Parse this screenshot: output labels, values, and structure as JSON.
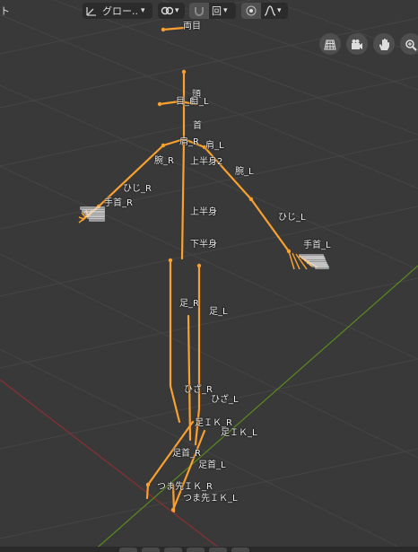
{
  "header": {
    "left_fragment": "ト",
    "transform_orientation": "グロー..",
    "snap_icon": "magnet-icon",
    "proportional_icon": "falloff-icon",
    "pivot_value": "回"
  },
  "nav_gizmos": [
    "grid-ortho-icon",
    "camera-icon",
    "hand-pan-icon",
    "zoom-icon"
  ],
  "bones": [
    {
      "name": "両目"
    },
    {
      "name": "頭"
    },
    {
      "name": "目_R"
    },
    {
      "name": "目_L"
    },
    {
      "name": "首"
    },
    {
      "name": "肩_R"
    },
    {
      "name": "肩_L"
    },
    {
      "name": "上半身2"
    },
    {
      "name": "腕_R"
    },
    {
      "name": "腕_L"
    },
    {
      "name": "ひじ_R"
    },
    {
      "name": "ひじ_L"
    },
    {
      "name": "上半身"
    },
    {
      "name": "下半身"
    },
    {
      "name": "手首_R"
    },
    {
      "name": "手首_L"
    },
    {
      "name": "足_R"
    },
    {
      "name": "足_L"
    },
    {
      "name": "ひざ_R"
    },
    {
      "name": "ひざ_L"
    },
    {
      "name": "足ＩＫ_R"
    },
    {
      "name": "足ＩＫ_L"
    },
    {
      "name": "足首_R"
    },
    {
      "name": "足首_L"
    },
    {
      "name": "つま先ＩＫ_R"
    },
    {
      "name": "つま先ＩＫ_L"
    }
  ],
  "colors": {
    "bone": "#f8a030",
    "x_axis": "#8a3030",
    "y_axis": "#5a8a1e",
    "background": "#393939"
  }
}
